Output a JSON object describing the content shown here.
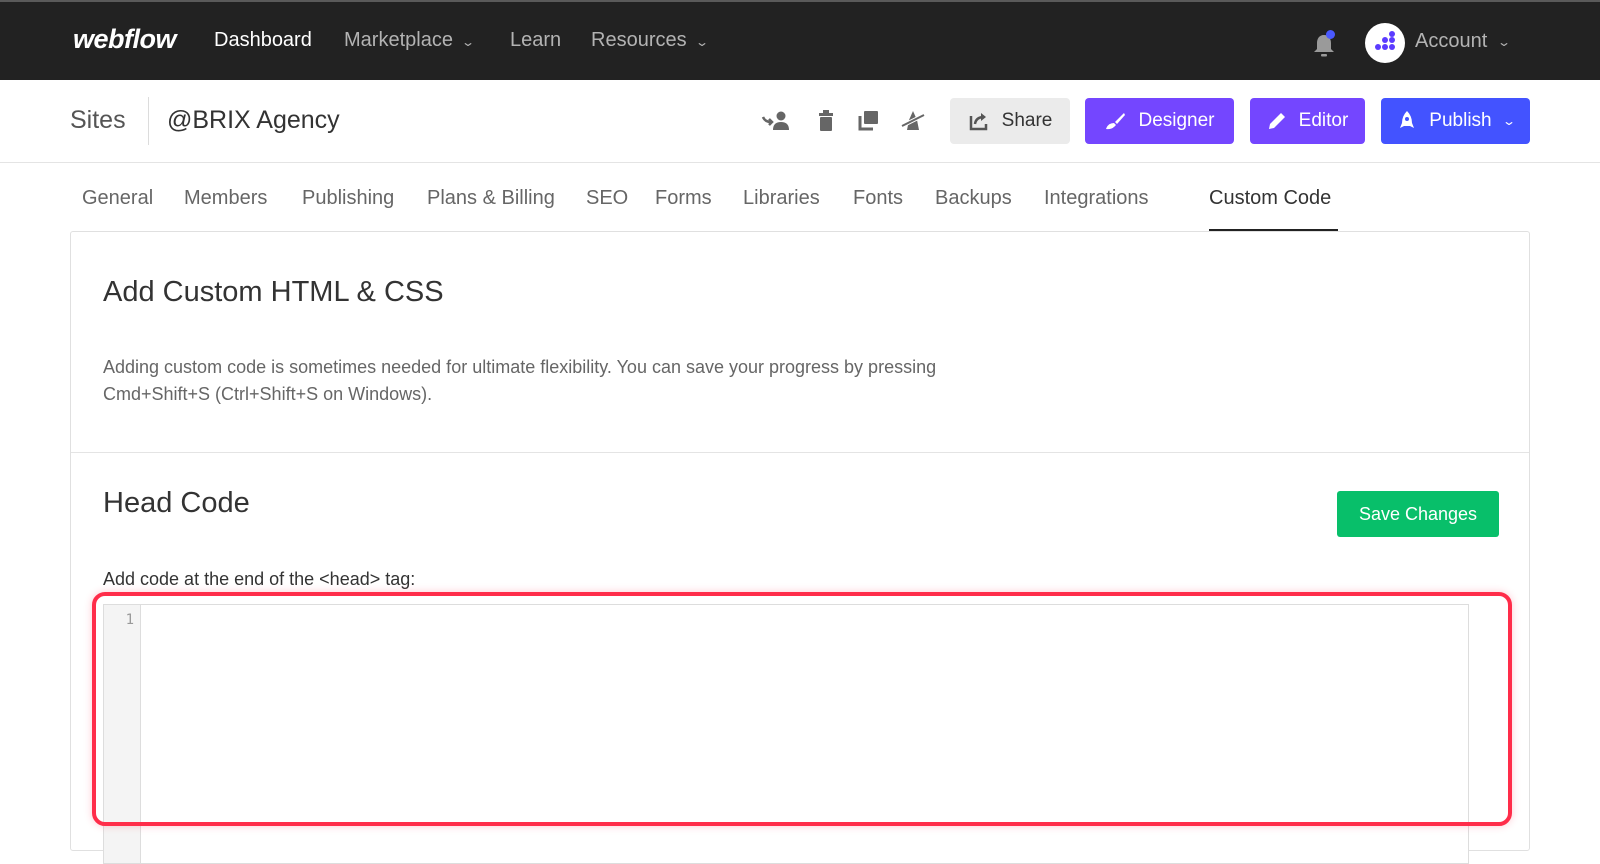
{
  "topnav": {
    "logo": "webflow",
    "items": [
      {
        "label": "Dashboard",
        "active": true,
        "dropdown": false
      },
      {
        "label": "Marketplace",
        "active": false,
        "dropdown": true
      },
      {
        "label": "Learn",
        "active": false,
        "dropdown": false
      },
      {
        "label": "Resources",
        "active": false,
        "dropdown": true
      }
    ],
    "chevron": "⌄",
    "account_label": "Account",
    "notification_icon": "bell-icon",
    "notification_badge_color": "#4a59ff"
  },
  "site_header": {
    "breadcrumb_root": "Sites",
    "site_name": "@BRIX Agency",
    "icons": [
      "transfer-user-icon",
      "trash-icon",
      "duplicate-icon",
      "unpublish-icon"
    ],
    "buttons": {
      "share": "Share",
      "designer": "Designer",
      "editor": "Editor",
      "publish": "Publish"
    },
    "colors": {
      "designer": "#7446ff",
      "editor": "#7446ff",
      "publish": "#4353ff"
    }
  },
  "tabs": [
    {
      "label": "General",
      "active": false
    },
    {
      "label": "Members",
      "active": false
    },
    {
      "label": "Publishing",
      "active": false
    },
    {
      "label": "Plans & Billing",
      "active": false
    },
    {
      "label": "SEO",
      "active": false
    },
    {
      "label": "Forms",
      "active": false
    },
    {
      "label": "Libraries",
      "active": false
    },
    {
      "label": "Fonts",
      "active": false
    },
    {
      "label": "Backups",
      "active": false
    },
    {
      "label": "Integrations",
      "active": false
    },
    {
      "label": "Custom Code",
      "active": true
    }
  ],
  "custom_code": {
    "title": "Add Custom HTML & CSS",
    "description": "Adding custom code is sometimes needed for ultimate flexibility. You can save your progress by pressing Cmd+Shift+S (Ctrl+Shift+S on Windows).",
    "head_code_title": "Head Code",
    "save_button": "Save Changes",
    "save_color": "#08bf6a",
    "head_code_label": "Add code at the end of the <head> tag:",
    "editor_line_number": "1",
    "editor_value": "",
    "highlight_color": "#ff2d4a"
  }
}
